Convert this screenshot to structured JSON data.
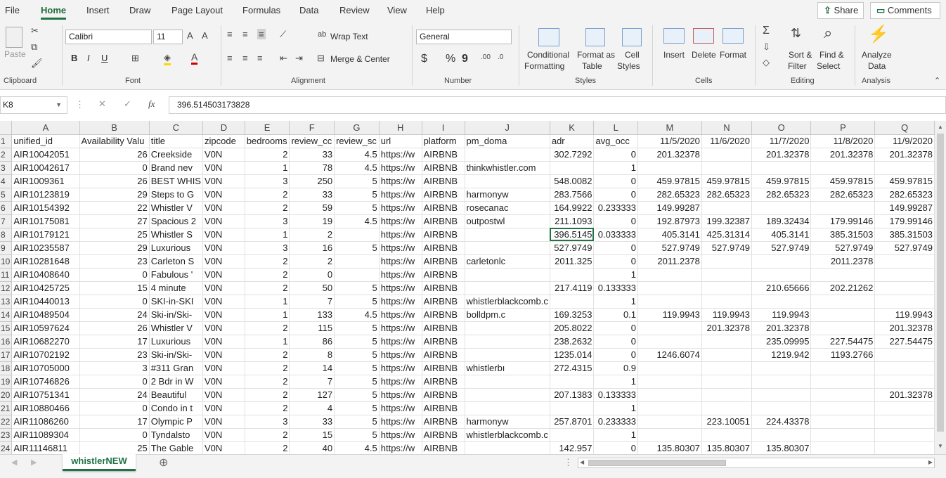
{
  "menu": {
    "tabs": [
      "File",
      "Home",
      "Insert",
      "Draw",
      "Page Layout",
      "Formulas",
      "Data",
      "Review",
      "View",
      "Help"
    ],
    "active": "Home",
    "share_label": "Share",
    "comments_label": "Comments"
  },
  "ribbon": {
    "clipboard": {
      "paste": "Paste",
      "group": "Clipboard"
    },
    "font": {
      "name": "Calibri",
      "size": "11",
      "bold": "B",
      "italic": "I",
      "underline": "U",
      "group": "Font"
    },
    "alignment": {
      "wrap": "Wrap Text",
      "merge": "Merge & Center",
      "group": "Alignment"
    },
    "number": {
      "format": "General",
      "currency": "$",
      "percent": "%",
      "comma": "9",
      "group": "Number"
    },
    "styles": {
      "conditional_1": "Conditional",
      "conditional_2": "Formatting",
      "format_table_1": "Format as",
      "format_table_2": "Table",
      "cell_styles_1": "Cell",
      "cell_styles_2": "Styles",
      "group": "Styles"
    },
    "cells": {
      "insert": "Insert",
      "delete": "Delete",
      "format": "Format",
      "group": "Cells"
    },
    "editing": {
      "sort_1": "Sort &",
      "sort_2": "Filter",
      "find_1": "Find &",
      "find_2": "Select",
      "group": "Editing"
    },
    "analysis": {
      "analyze_1": "Analyze",
      "analyze_2": "Data",
      "group": "Analysis"
    }
  },
  "formula_bar": {
    "name_box": "K8",
    "fx": "fx",
    "value": "396.514503173828"
  },
  "columns": [
    "A",
    "B",
    "C",
    "D",
    "E",
    "F",
    "G",
    "H",
    "I",
    "J",
    "K",
    "L",
    "M",
    "N",
    "O",
    "P",
    "Q"
  ],
  "rows": [
    [
      "unified_id",
      "Availability Valu",
      "title",
      "zipcode",
      "bedrooms",
      "review_cc",
      "review_sc",
      "url",
      "platform",
      "pm_doma",
      "adr",
      "avg_occ",
      "11/5/2020",
      "11/6/2020",
      "11/7/2020",
      "11/8/2020",
      "11/9/2020"
    ],
    [
      "AIR10042051",
      "26",
      "Creekside",
      "V0N",
      "2",
      "33",
      "4.5",
      "https://w",
      "AIRBNB",
      "",
      "302.7292",
      "0",
      "201.32378",
      "",
      "201.32378",
      "201.32378",
      "201.32378"
    ],
    [
      "AIR10042617",
      "0",
      "Brand nev",
      "V0N",
      "1",
      "78",
      "4.5",
      "https://w",
      "AIRBNB",
      "thinkwhistler.com",
      "",
      "1",
      "",
      "",
      "",
      "",
      ""
    ],
    [
      "AIR1009361",
      "26",
      "BEST WHIS",
      "V0N",
      "3",
      "250",
      "5",
      "https://w",
      "AIRBNB",
      "",
      "548.0082",
      "0",
      "459.97815",
      "459.97815",
      "459.97815",
      "459.97815",
      "459.97815"
    ],
    [
      "AIR10123819",
      "29",
      "Steps to G",
      "V0N",
      "2",
      "33",
      "5",
      "https://w",
      "AIRBNB",
      "harmonyw",
      "283.7566",
      "0",
      "282.65323",
      "282.65323",
      "282.65323",
      "282.65323",
      "282.65323"
    ],
    [
      "AIR10154392",
      "22",
      "Whistler V",
      "V0N",
      "2",
      "59",
      "5",
      "https://w",
      "AIRBNB",
      "rosecanac",
      "164.9922",
      "0.233333",
      "149.99287",
      "",
      "",
      "",
      "149.99287"
    ],
    [
      "AIR10175081",
      "27",
      "Spacious 2",
      "V0N",
      "3",
      "19",
      "4.5",
      "https://w",
      "AIRBNB",
      "outpostwl",
      "211.1093",
      "0",
      "192.87973",
      "199.32387",
      "189.32434",
      "179.99146",
      "179.99146"
    ],
    [
      "AIR10179121",
      "25",
      "Whistler S",
      "V0N",
      "1",
      "2",
      "",
      "https://w",
      "AIRBNB",
      "",
      "396.5145",
      "0.033333",
      "405.3141",
      "425.31314",
      "405.3141",
      "385.31503",
      "385.31503"
    ],
    [
      "AIR10235587",
      "29",
      "Luxurious",
      "V0N",
      "3",
      "16",
      "5",
      "https://w",
      "AIRBNB",
      "",
      "527.9749",
      "0",
      "527.9749",
      "527.9749",
      "527.9749",
      "527.9749",
      "527.9749"
    ],
    [
      "AIR10281648",
      "23",
      "Carleton S",
      "V0N",
      "2",
      "2",
      "",
      "https://w",
      "AIRBNB",
      "carletonlc",
      "2011.325",
      "0",
      "2011.2378",
      "",
      "",
      "2011.2378",
      ""
    ],
    [
      "AIR10408640",
      "0",
      "Fabulous '",
      "V0N",
      "2",
      "0",
      "",
      "https://w",
      "AIRBNB",
      "",
      "",
      "1",
      "",
      "",
      "",
      "",
      ""
    ],
    [
      "AIR10425725",
      "15",
      "4 minute",
      "V0N",
      "2",
      "50",
      "5",
      "https://w",
      "AIRBNB",
      "",
      "217.4119",
      "0.133333",
      "",
      "",
      "210.65666",
      "202.21262",
      ""
    ],
    [
      "AIR10440013",
      "0",
      "SKI-in-SKI",
      "V0N",
      "1",
      "7",
      "5",
      "https://w",
      "AIRBNB",
      "whistlerblackcomb.c",
      "",
      "1",
      "",
      "",
      "",
      "",
      ""
    ],
    [
      "AIR10489504",
      "24",
      "Ski-in/Ski-",
      "V0N",
      "1",
      "133",
      "4.5",
      "https://w",
      "AIRBNB",
      "bolldpm.c",
      "169.3253",
      "0.1",
      "119.9943",
      "119.9943",
      "119.9943",
      "",
      "119.9943"
    ],
    [
      "AIR10597624",
      "26",
      "Whistler V",
      "V0N",
      "2",
      "115",
      "5",
      "https://w",
      "AIRBNB",
      "",
      "205.8022",
      "0",
      "",
      "201.32378",
      "201.32378",
      "",
      "201.32378"
    ],
    [
      "AIR10682270",
      "17",
      "Luxurious",
      "V0N",
      "1",
      "86",
      "5",
      "https://w",
      "AIRBNB",
      "",
      "238.2632",
      "0",
      "",
      "",
      "235.09995",
      "227.54475",
      "227.54475"
    ],
    [
      "AIR10702192",
      "23",
      "Ski-in/Ski-",
      "V0N",
      "2",
      "8",
      "5",
      "https://w",
      "AIRBNB",
      "",
      "1235.014",
      "0",
      "1246.6074",
      "",
      "1219.942",
      "1193.2766",
      ""
    ],
    [
      "AIR10705000",
      "3",
      "#311 Gran",
      "V0N",
      "2",
      "14",
      "5",
      "https://w",
      "AIRBNB",
      "whistlerbı",
      "272.4315",
      "0.9",
      "",
      "",
      "",
      "",
      ""
    ],
    [
      "AIR10746826",
      "0",
      "2 Bdr in W",
      "V0N",
      "2",
      "7",
      "5",
      "https://w",
      "AIRBNB",
      "",
      "",
      "1",
      "",
      "",
      "",
      "",
      ""
    ],
    [
      "AIR10751341",
      "24",
      "Beautiful",
      "V0N",
      "2",
      "127",
      "5",
      "https://w",
      "AIRBNB",
      "",
      "207.1383",
      "0.133333",
      "",
      "",
      "",
      "",
      "201.32378"
    ],
    [
      "AIR10880466",
      "0",
      "Condo in t",
      "V0N",
      "2",
      "4",
      "5",
      "https://w",
      "AIRBNB",
      "",
      "",
      "1",
      "",
      "",
      "",
      "",
      ""
    ],
    [
      "AIR11086260",
      "17",
      "Olympic P",
      "V0N",
      "3",
      "33",
      "5",
      "https://w",
      "AIRBNB",
      "harmonyw",
      "257.8701",
      "0.233333",
      "",
      "223.10051",
      "224.43378",
      "",
      ""
    ],
    [
      "AIR11089304",
      "0",
      "Tyndalsto",
      "V0N",
      "2",
      "15",
      "5",
      "https://w",
      "AIRBNB",
      "whistlerblackcomb.c",
      "",
      "1",
      "",
      "",
      "",
      "",
      ""
    ],
    [
      "AIR11146811",
      "25",
      "The Gable",
      "V0N",
      "2",
      "40",
      "4.5",
      "https://w",
      "AIRBNB",
      "",
      "142.957",
      "0",
      "135.80307",
      "135.80307",
      "135.80307",
      "",
      ""
    ]
  ],
  "sheet_tab": "whistlerNEW"
}
